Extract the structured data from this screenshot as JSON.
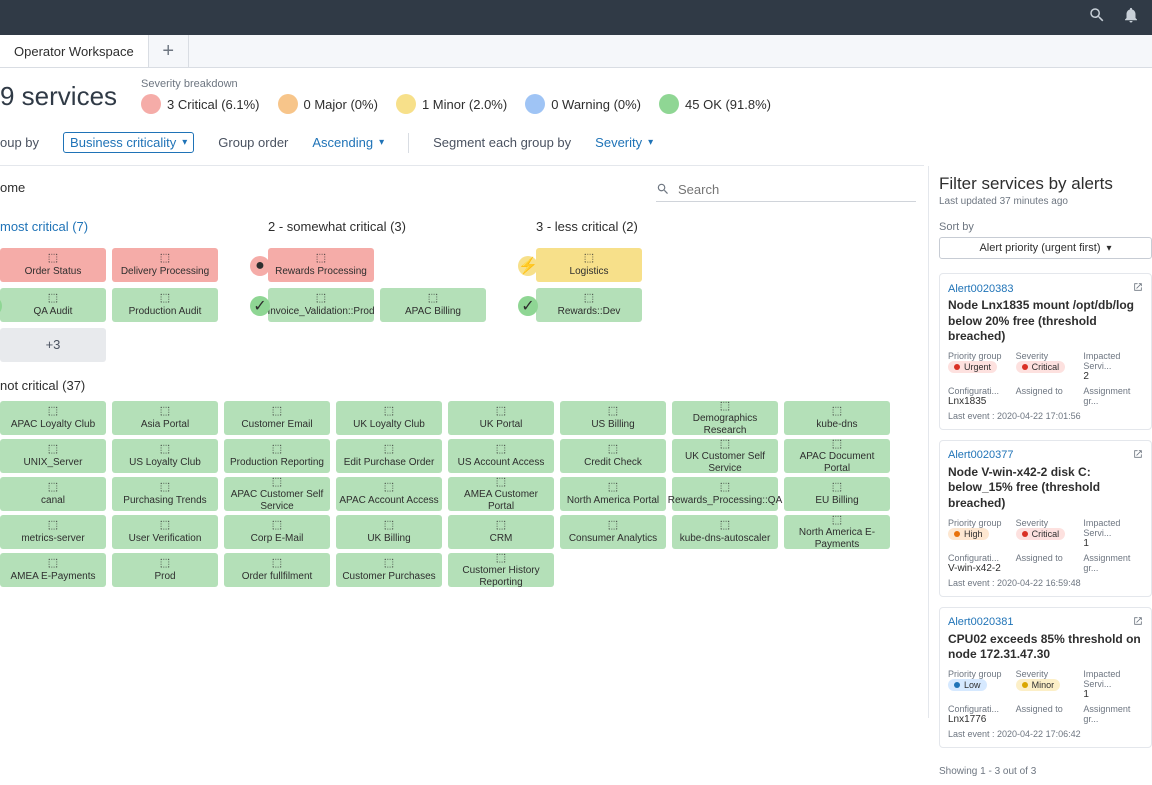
{
  "tab": {
    "title": "Operator Workspace"
  },
  "header": {
    "title": "9 services",
    "sev_label": "Severity breakdown",
    "sev": [
      {
        "label": "3 Critical (6.1%)",
        "color": "#f5aca8"
      },
      {
        "label": "0 Major (0%)",
        "color": "#f7c58a"
      },
      {
        "label": "1 Minor (2.0%)",
        "color": "#f7e08a"
      },
      {
        "label": "0 Warning (0%)",
        "color": "#9fc4f5"
      },
      {
        "label": "45 OK (91.8%)",
        "color": "#8fd694"
      }
    ]
  },
  "controls": {
    "groupby_label": "oup by",
    "groupby_value": "Business criticality",
    "order_label": "Group order",
    "order_value": "Ascending",
    "segment_label": "Segment each group by",
    "segment_value": "Severity"
  },
  "search": {
    "placeholder": "Search"
  },
  "sections": {
    "ome": "ome",
    "most": "most critical (7)",
    "somewhat": "2 - somewhat critical (3)",
    "less": "3 - less critical (2)",
    "not": "not critical (37)",
    "more": "+3"
  },
  "most_row1": [
    "Order Status",
    "Delivery Processing"
  ],
  "most_row2": [
    "QA Audit",
    "Production Audit"
  ],
  "somewhat_row1": [
    "Rewards Processing"
  ],
  "somewhat_row2": [
    "Invoice_Validation::Prod",
    "APAC Billing"
  ],
  "less_row1": [
    "Logistics"
  ],
  "less_row2": [
    "Rewards::Dev"
  ],
  "not_rows": [
    [
      "APAC Loyalty Club",
      "Asia Portal",
      "Customer Email",
      "UK Loyalty Club",
      "UK Portal",
      "US Billing",
      "Demographics Research",
      "kube-dns"
    ],
    [
      "UNIX_Server",
      "US Loyalty Club",
      "Production Reporting",
      "Edit Purchase Order",
      "US Account Access",
      "Credit Check",
      "UK Customer Self Service",
      "APAC Document Portal"
    ],
    [
      "canal",
      "Purchasing Trends",
      "APAC Customer Self Service",
      "APAC Account Access",
      "AMEA Customer Portal",
      "North America Portal",
      "Rewards_Processing::QA",
      "EU Billing"
    ],
    [
      "metrics-server",
      "User Verification",
      "Corp E-Mail",
      "UK Billing",
      "CRM",
      "Consumer Analytics",
      "kube-dns-autoscaler",
      "North America E-Payments"
    ],
    [
      "AMEA E-Payments",
      "Prod",
      "Order fullfilment",
      "Customer Purchases",
      "Customer History Reporting"
    ]
  ],
  "filter": {
    "title": "Filter services by alerts",
    "updated": "Last updated 37 minutes ago",
    "sort_label": "Sort by",
    "sort_value": "Alert priority (urgent first)",
    "showing": "Showing 1 - 3 out of 3"
  },
  "alerts": [
    {
      "id": "Alert0020383",
      "title": "Node Lnx1835 mount /opt/db/log below 20% free (threshold breached)",
      "pg_label": "Priority group",
      "pg_badge": "Urgent",
      "pg_class": "urgent",
      "sev_label": "Severity",
      "sev_badge": "Critical",
      "sev_class": "critical",
      "imp_label": "Impacted Servi...",
      "imp_val": "2",
      "ci_label": "Configurati...",
      "ci_val": "Lnx1835",
      "at_label": "Assigned to",
      "ag_label": "Assignment gr...",
      "foot": "Last event : 2020-04-22 17:01:56"
    },
    {
      "id": "Alert0020377",
      "title": "Node V-win-x42-2 disk C: below_15% free (threshold breached)",
      "pg_label": "Priority group",
      "pg_badge": "High",
      "pg_class": "high",
      "sev_label": "Severity",
      "sev_badge": "Critical",
      "sev_class": "critical",
      "imp_label": "Impacted Servi...",
      "imp_val": "1",
      "ci_label": "Configurati...",
      "ci_val": "V-win-x42-2",
      "at_label": "Assigned to",
      "ag_label": "Assignment gr...",
      "foot": "Last event : 2020-04-22 16:59:48"
    },
    {
      "id": "Alert0020381",
      "title": "CPU02 exceeds 85% threshold on node 172.31.47.30",
      "pg_label": "Priority group",
      "pg_badge": "Low",
      "pg_class": "low",
      "sev_label": "Severity",
      "sev_badge": "Minor",
      "sev_class": "minor",
      "imp_label": "Impacted Servi...",
      "imp_val": "1",
      "ci_label": "Configurati...",
      "ci_val": "Lnx1776",
      "at_label": "Assigned to",
      "ag_label": "Assignment gr...",
      "foot": "Last event : 2020-04-22 17:06:42"
    }
  ]
}
